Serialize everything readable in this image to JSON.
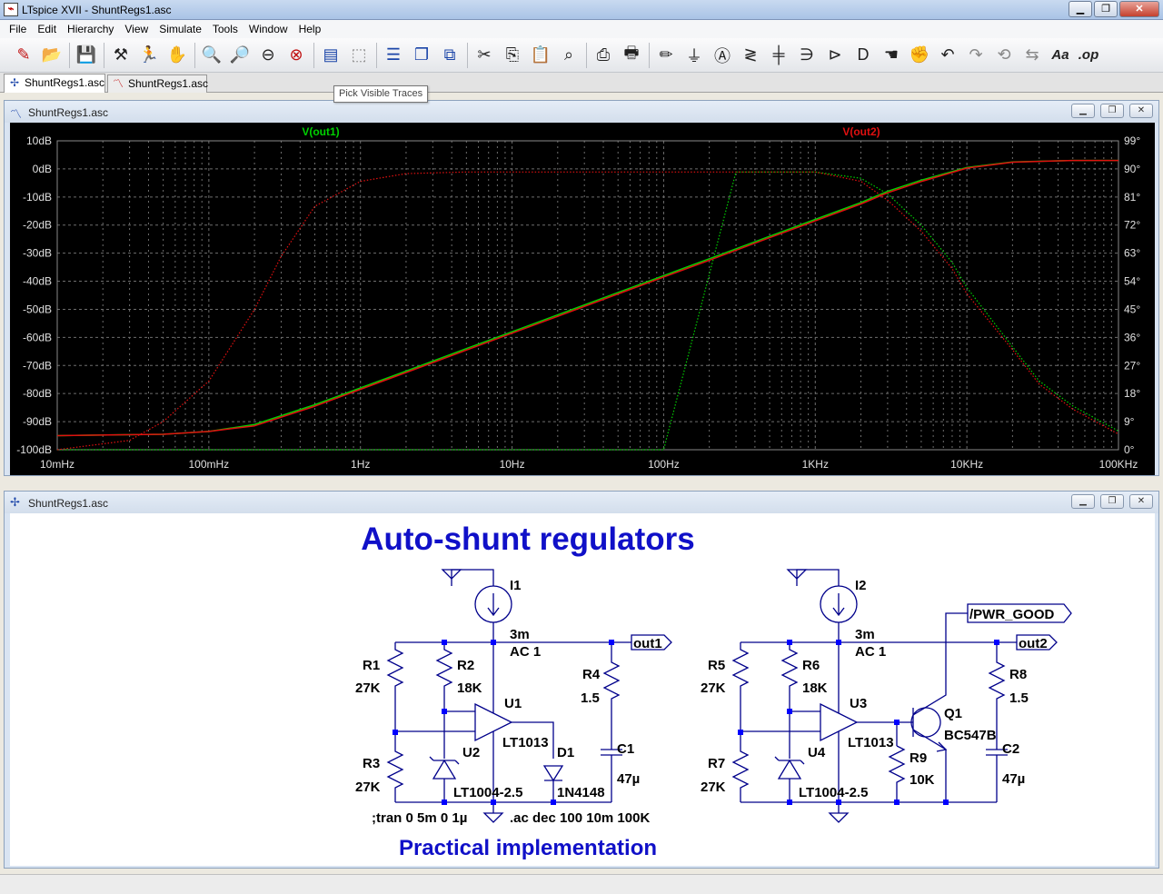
{
  "window": {
    "title": "LTspice XVII - ShuntRegs1.asc",
    "icon": "ltspice-app-icon"
  },
  "menu": [
    {
      "label": "File"
    },
    {
      "label": "Edit"
    },
    {
      "label": "Hierarchy"
    },
    {
      "label": "View"
    },
    {
      "label": "Simulate"
    },
    {
      "label": "Tools"
    },
    {
      "label": "Window"
    },
    {
      "label": "Help"
    }
  ],
  "toolbar_text": {
    "text_tool": "Aa",
    "spice_directive": ".op"
  },
  "tabs": [
    {
      "label": "ShuntRegs1.asc",
      "icon": "schematic-icon",
      "active": true
    },
    {
      "label": "ShuntRegs1.asc",
      "icon": "waveform-icon",
      "active": false
    }
  ],
  "tooltip": "Pick Visible Traces",
  "plot_window": {
    "title": "ShuntRegs1.asc",
    "icon": "waveform-icon"
  },
  "schematic_window": {
    "title": "ShuntRegs1.asc",
    "icon": "schematic-icon"
  },
  "chart_data": {
    "type": "line",
    "x_scale": "log",
    "xlim": [
      0.01,
      100000
    ],
    "x_ticks": [
      "10mHz",
      "100mHz",
      "1Hz",
      "10Hz",
      "100Hz",
      "1KHz",
      "10KHz",
      "100KHz"
    ],
    "y_left_ticks": [
      "10dB",
      "0dB",
      "-10dB",
      "-20dB",
      "-30dB",
      "-40dB",
      "-50dB",
      "-60dB",
      "-70dB",
      "-80dB",
      "-90dB",
      "-100dB"
    ],
    "y_right_ticks": [
      "99°",
      "90°",
      "81°",
      "72°",
      "63°",
      "54°",
      "45°",
      "36°",
      "27°",
      "18°",
      "9°",
      "0°"
    ],
    "ylim": [
      -100,
      10
    ],
    "y2lim": [
      0,
      99
    ],
    "grid": true,
    "background": "#000000",
    "series": [
      {
        "name": "V(out1)",
        "color": "#00d000",
        "mag_db": [
          [
            0.01,
            -95
          ],
          [
            0.05,
            -94.5
          ],
          [
            0.1,
            -93.5
          ],
          [
            0.2,
            -91
          ],
          [
            0.5,
            -84
          ],
          [
            1,
            -78
          ],
          [
            2,
            -72
          ],
          [
            5,
            -64
          ],
          [
            10,
            -58
          ],
          [
            20,
            -52
          ],
          [
            50,
            -44
          ],
          [
            100,
            -38
          ],
          [
            200,
            -32
          ],
          [
            500,
            -24
          ],
          [
            1000,
            -18
          ],
          [
            2000,
            -12
          ],
          [
            3000,
            -8
          ],
          [
            5000,
            -4
          ],
          [
            10000,
            0.5
          ],
          [
            20000,
            2.5
          ],
          [
            50000,
            3
          ],
          [
            100000,
            3
          ]
        ],
        "phase_deg": [
          [
            0.01,
            0
          ],
          [
            0.5,
            0
          ],
          [
            1,
            0
          ],
          [
            100,
            0
          ],
          [
            300,
            89
          ],
          [
            1000,
            89
          ],
          [
            2000,
            87
          ],
          [
            3000,
            82
          ],
          [
            5000,
            72
          ],
          [
            8000,
            60
          ],
          [
            10000,
            52
          ],
          [
            20000,
            33
          ],
          [
            30000,
            22
          ],
          [
            50000,
            14
          ],
          [
            100000,
            6
          ]
        ]
      },
      {
        "name": "V(out2)",
        "color": "#e01010",
        "mag_db": [
          [
            0.01,
            -95
          ],
          [
            0.05,
            -94.5
          ],
          [
            0.1,
            -93.5
          ],
          [
            0.2,
            -91.5
          ],
          [
            0.5,
            -84.5
          ],
          [
            1,
            -78.5
          ],
          [
            2,
            -72.5
          ],
          [
            5,
            -64.5
          ],
          [
            10,
            -58.5
          ],
          [
            20,
            -52.5
          ],
          [
            50,
            -44.5
          ],
          [
            100,
            -38.5
          ],
          [
            200,
            -32.5
          ],
          [
            500,
            -24.5
          ],
          [
            1000,
            -18.5
          ],
          [
            2000,
            -12.5
          ],
          [
            3000,
            -8.5
          ],
          [
            5000,
            -4.5
          ],
          [
            10000,
            0.3
          ],
          [
            20000,
            2.4
          ],
          [
            50000,
            3
          ],
          [
            100000,
            3
          ]
        ],
        "phase_deg": [
          [
            0.01,
            0
          ],
          [
            0.03,
            3
          ],
          [
            0.05,
            9
          ],
          [
            0.1,
            22
          ],
          [
            0.2,
            45
          ],
          [
            0.3,
            62
          ],
          [
            0.5,
            78
          ],
          [
            1,
            86
          ],
          [
            2,
            88.5
          ],
          [
            5,
            89
          ],
          [
            100,
            89
          ],
          [
            1000,
            89
          ],
          [
            2000,
            86
          ],
          [
            3000,
            80
          ],
          [
            5000,
            70
          ],
          [
            8000,
            58
          ],
          [
            10000,
            50
          ],
          [
            20000,
            32
          ],
          [
            30000,
            21
          ],
          [
            50000,
            13
          ],
          [
            100000,
            5
          ]
        ]
      }
    ]
  },
  "schematic": {
    "title": "Auto-shunt regulators",
    "subtitle": "Practical implementation",
    "directives": {
      "tran": ";tran 0 5m 0 1µ",
      "ac": ".ac dec 100 10m 100K"
    },
    "left": {
      "I1": {
        "name": "I1",
        "value": "3m",
        "ac": "AC 1"
      },
      "R1": {
        "name": "R1",
        "value": "27K"
      },
      "R2": {
        "name": "R2",
        "value": "18K"
      },
      "R3": {
        "name": "R3",
        "value": "27K"
      },
      "R4": {
        "name": "R4",
        "value": "1.5"
      },
      "U1": {
        "name": "U1",
        "value": "LT1013"
      },
      "U2": {
        "name": "U2",
        "value": "LT1004-2.5"
      },
      "D1": {
        "name": "D1",
        "value": "1N4148"
      },
      "C1": {
        "name": "C1",
        "value": "47µ"
      },
      "out": "out1"
    },
    "right": {
      "I2": {
        "name": "I2",
        "value": "3m",
        "ac": "AC 1"
      },
      "R5": {
        "name": "R5",
        "value": "27K"
      },
      "R6": {
        "name": "R6",
        "value": "18K"
      },
      "R7": {
        "name": "R7",
        "value": "27K"
      },
      "R8": {
        "name": "R8",
        "value": "1.5"
      },
      "R9": {
        "name": "R9",
        "value": "10K"
      },
      "U3": {
        "name": "U3",
        "value": "LT1013"
      },
      "U4": {
        "name": "U4",
        "value": "LT1004-2.5"
      },
      "Q1": {
        "name": "Q1",
        "value": "BC547B"
      },
      "C2": {
        "name": "C2",
        "value": "47µ"
      },
      "out": "out2",
      "pwr_good": "/PWR_GOOD"
    }
  }
}
